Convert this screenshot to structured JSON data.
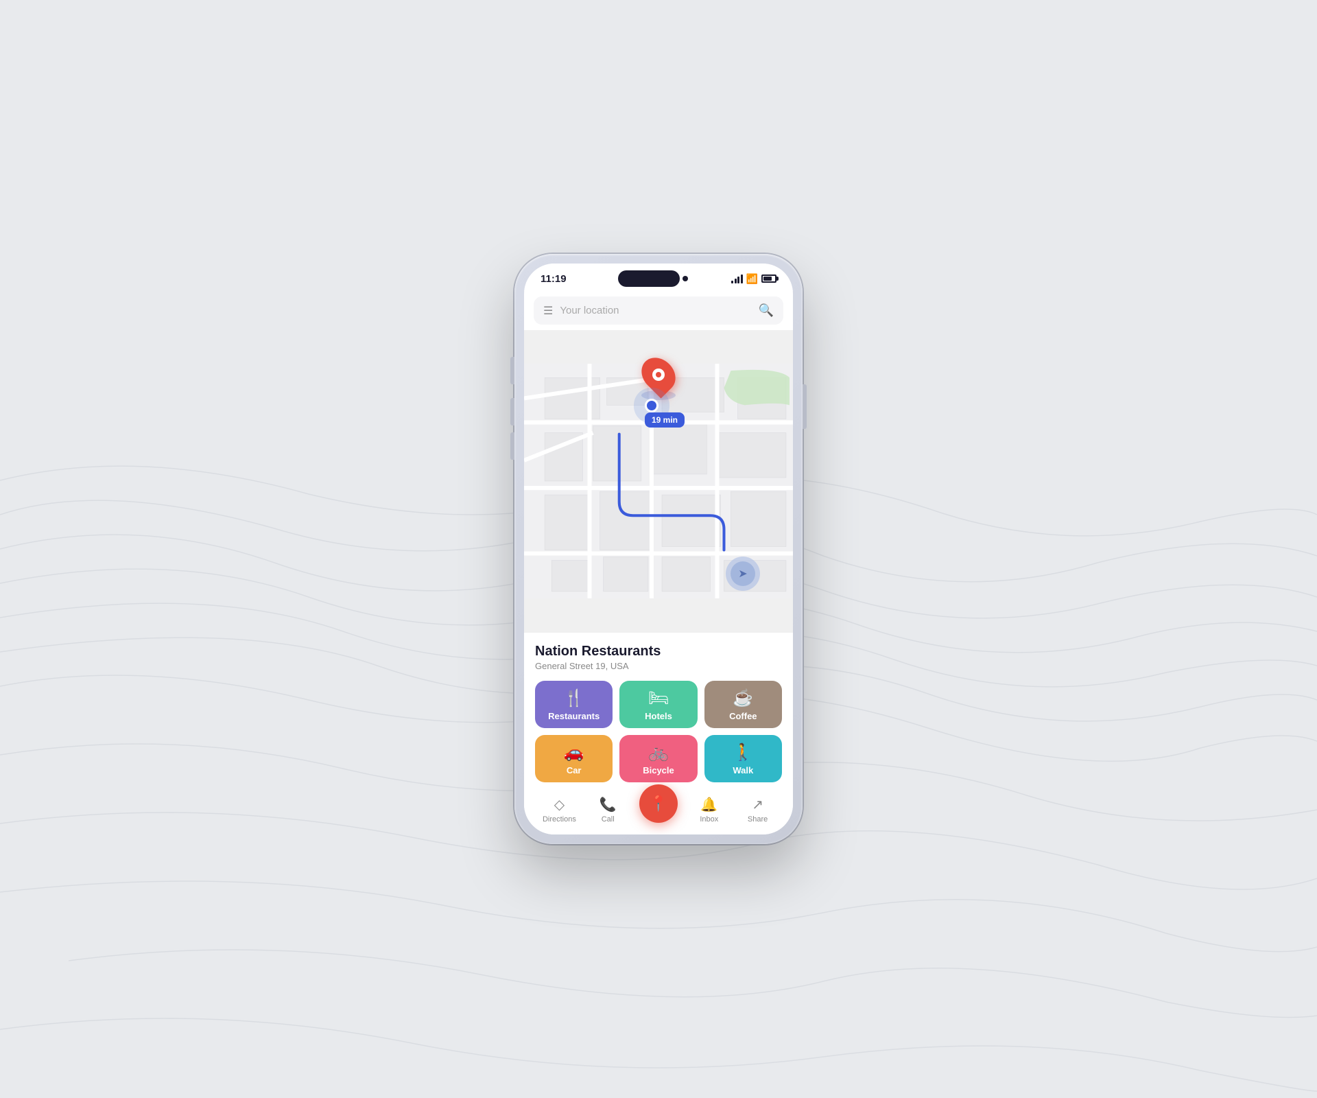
{
  "status_bar": {
    "time": "11:19",
    "signal": "signal",
    "wifi": "wifi",
    "battery": "battery"
  },
  "search": {
    "placeholder": "Your location"
  },
  "map": {
    "time_badge": "19 min"
  },
  "place": {
    "name": "Nation Restaurants",
    "address": "General Street 19, USA"
  },
  "categories": [
    {
      "id": "restaurants",
      "label": "Restaurants",
      "icon": "🍴",
      "color_class": "cat-restaurants"
    },
    {
      "id": "hotels",
      "label": "Hotels",
      "icon": "🛏",
      "color_class": "cat-hotels"
    },
    {
      "id": "coffee",
      "label": "Coffee",
      "icon": "☕",
      "color_class": "cat-coffee"
    },
    {
      "id": "car",
      "label": "Car",
      "icon": "🚗",
      "color_class": "cat-car"
    },
    {
      "id": "bicycle",
      "label": "Bicycle",
      "icon": "🚲",
      "color_class": "cat-bicycle"
    },
    {
      "id": "walk",
      "label": "Walk",
      "icon": "🚶",
      "color_class": "cat-walk"
    }
  ],
  "nav": {
    "items": [
      {
        "id": "directions",
        "label": "Directions",
        "icon": "◇"
      },
      {
        "id": "call",
        "label": "Call",
        "icon": "📞"
      },
      {
        "id": "center",
        "label": "",
        "icon": "📍"
      },
      {
        "id": "inbox",
        "label": "Inbox",
        "icon": "🔔"
      },
      {
        "id": "share",
        "label": "Share",
        "icon": "↗"
      }
    ]
  }
}
